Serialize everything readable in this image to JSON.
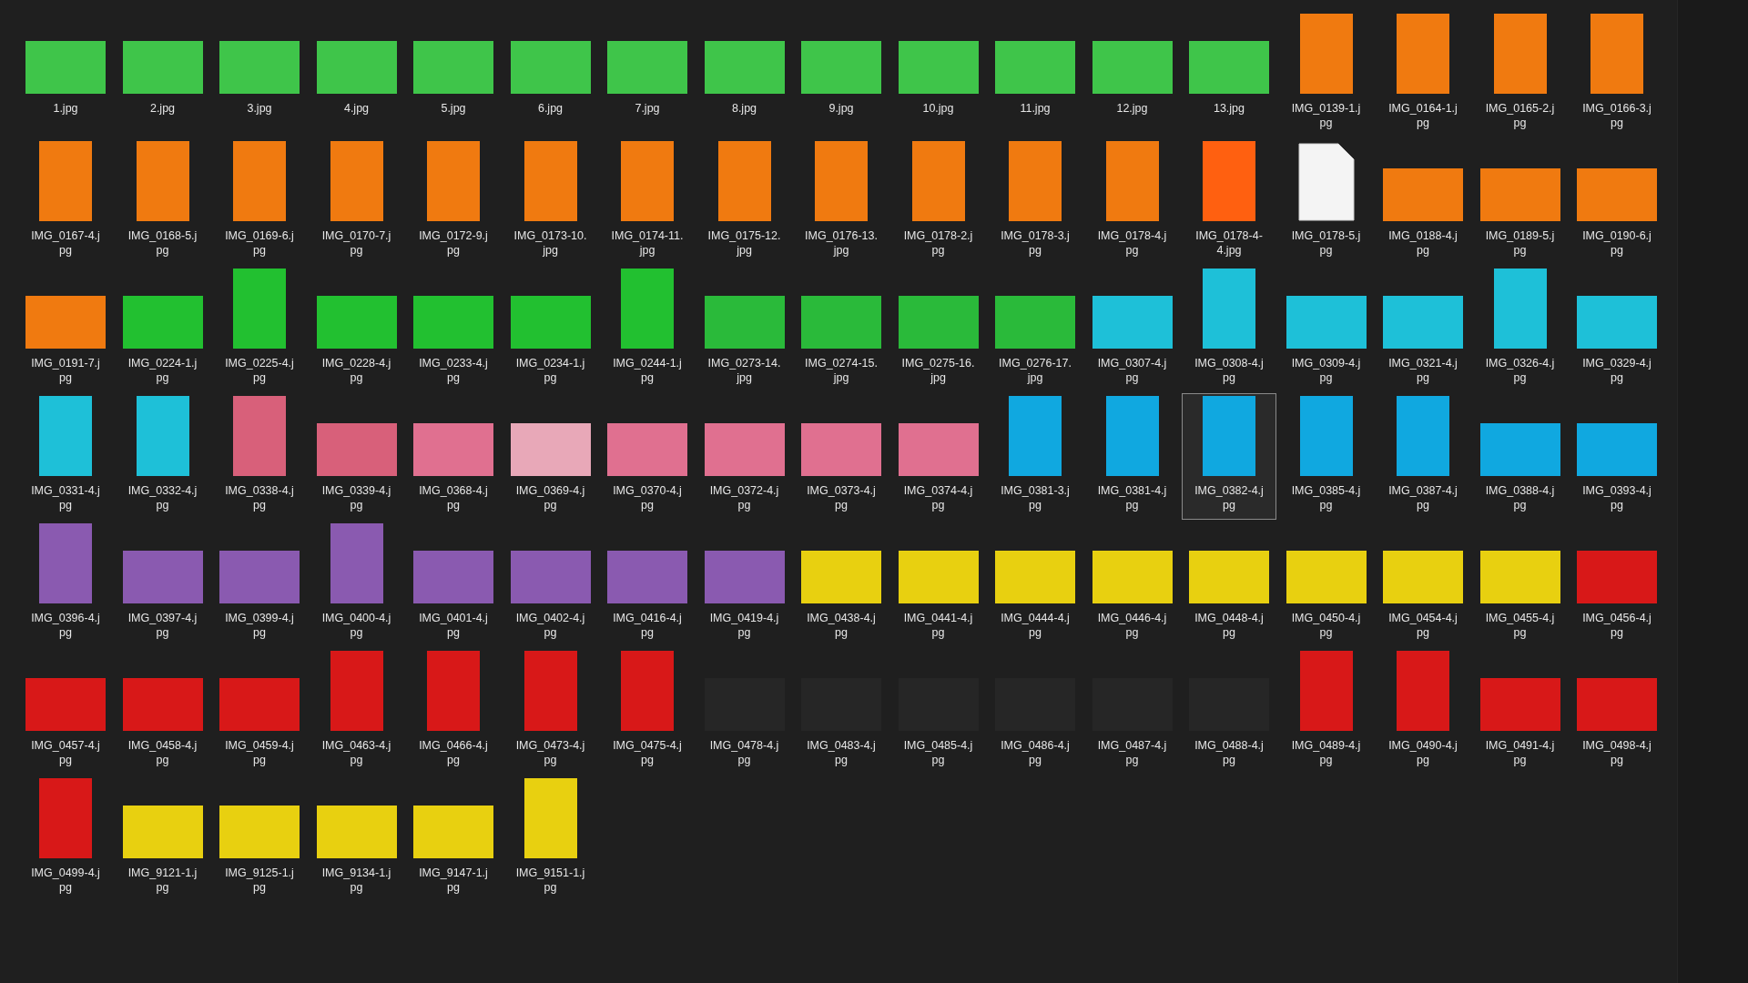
{
  "files": [
    {
      "name": "1.jpg",
      "kind": "landscape",
      "color": "#3fc54a",
      "selected": false
    },
    {
      "name": "2.jpg",
      "kind": "landscape",
      "color": "#3fc54a",
      "selected": false
    },
    {
      "name": "3.jpg",
      "kind": "landscape",
      "color": "#3fc54a",
      "selected": false
    },
    {
      "name": "4.jpg",
      "kind": "landscape",
      "color": "#3fc54a",
      "selected": false
    },
    {
      "name": "5.jpg",
      "kind": "landscape",
      "color": "#3fc54a",
      "selected": false
    },
    {
      "name": "6.jpg",
      "kind": "landscape",
      "color": "#3fc54a",
      "selected": false
    },
    {
      "name": "7.jpg",
      "kind": "landscape",
      "color": "#3fc54a",
      "selected": false
    },
    {
      "name": "8.jpg",
      "kind": "landscape",
      "color": "#3fc54a",
      "selected": false
    },
    {
      "name": "9.jpg",
      "kind": "landscape",
      "color": "#3fc54a",
      "selected": false
    },
    {
      "name": "10.jpg",
      "kind": "landscape",
      "color": "#3fc54a",
      "selected": false
    },
    {
      "name": "11.jpg",
      "kind": "landscape",
      "color": "#3fc54a",
      "selected": false
    },
    {
      "name": "12.jpg",
      "kind": "landscape",
      "color": "#3fc54a",
      "selected": false
    },
    {
      "name": "13.jpg",
      "kind": "landscape",
      "color": "#3fc54a",
      "selected": false
    },
    {
      "name": "IMG_0139-1.jpg",
      "kind": "portrait",
      "color": "#f07a10",
      "selected": false
    },
    {
      "name": "IMG_0164-1.jpg",
      "kind": "portrait",
      "color": "#f07a10",
      "selected": false
    },
    {
      "name": "IMG_0165-2.jpg",
      "kind": "portrait",
      "color": "#f07a10",
      "selected": false
    },
    {
      "name": "IMG_0166-3.jpg",
      "kind": "portrait",
      "color": "#f07a10",
      "selected": false
    },
    {
      "name": "IMG_0167-4.jpg",
      "kind": "portrait",
      "color": "#f07a10",
      "selected": false
    },
    {
      "name": "IMG_0168-5.jpg",
      "kind": "portrait",
      "color": "#f07a10",
      "selected": false
    },
    {
      "name": "IMG_0169-6.jpg",
      "kind": "portrait",
      "color": "#f07a10",
      "selected": false
    },
    {
      "name": "IMG_0170-7.jpg",
      "kind": "portrait",
      "color": "#f07a10",
      "selected": false
    },
    {
      "name": "IMG_0172-9.jpg",
      "kind": "portrait",
      "color": "#f07a10",
      "selected": false
    },
    {
      "name": "IMG_0173-10.jpg",
      "kind": "portrait",
      "color": "#f07a10",
      "selected": false
    },
    {
      "name": "IMG_0174-11.jpg",
      "kind": "portrait",
      "color": "#f07a10",
      "selected": false
    },
    {
      "name": "IMG_0175-12.jpg",
      "kind": "portrait",
      "color": "#f07a10",
      "selected": false
    },
    {
      "name": "IMG_0176-13.jpg",
      "kind": "portrait",
      "color": "#f07a10",
      "selected": false
    },
    {
      "name": "IMG_0178-2.jpg",
      "kind": "portrait",
      "color": "#f07a10",
      "selected": false
    },
    {
      "name": "IMG_0178-3.jpg",
      "kind": "portrait",
      "color": "#f07a10",
      "selected": false
    },
    {
      "name": "IMG_0178-4.jpg",
      "kind": "portrait",
      "color": "#f07a10",
      "selected": false
    },
    {
      "name": "IMG_0178-4-4.jpg",
      "kind": "portrait",
      "color": "#ff6010",
      "selected": false
    },
    {
      "name": "IMG_0178-5.jpg",
      "kind": "document",
      "color": "#f4f4f4",
      "selected": false
    },
    {
      "name": "IMG_0188-4.jpg",
      "kind": "landscape",
      "color": "#f07a10",
      "selected": false
    },
    {
      "name": "IMG_0189-5.jpg",
      "kind": "landscape",
      "color": "#f07a10",
      "selected": false
    },
    {
      "name": "IMG_0190-6.jpg",
      "kind": "landscape",
      "color": "#f07a10",
      "selected": false
    },
    {
      "name": "IMG_0191-7.jpg",
      "kind": "landscape",
      "color": "#f07a10",
      "selected": false
    },
    {
      "name": "IMG_0224-1.jpg",
      "kind": "landscape",
      "color": "#22c030",
      "selected": false
    },
    {
      "name": "IMG_0225-4.jpg",
      "kind": "portrait",
      "color": "#22c030",
      "selected": false
    },
    {
      "name": "IMG_0228-4.jpg",
      "kind": "landscape",
      "color": "#22c030",
      "selected": false
    },
    {
      "name": "IMG_0233-4.jpg",
      "kind": "landscape",
      "color": "#22c030",
      "selected": false
    },
    {
      "name": "IMG_0234-1.jpg",
      "kind": "landscape",
      "color": "#22c030",
      "selected": false
    },
    {
      "name": "IMG_0244-1.jpg",
      "kind": "portrait",
      "color": "#22c030",
      "selected": false
    },
    {
      "name": "IMG_0273-14.jpg",
      "kind": "landscape",
      "color": "#2aba3a",
      "selected": false
    },
    {
      "name": "IMG_0274-15.jpg",
      "kind": "landscape",
      "color": "#2aba3a",
      "selected": false
    },
    {
      "name": "IMG_0275-16.jpg",
      "kind": "landscape",
      "color": "#2aba3a",
      "selected": false
    },
    {
      "name": "IMG_0276-17.jpg",
      "kind": "landscape",
      "color": "#2aba3a",
      "selected": false
    },
    {
      "name": "IMG_0307-4.jpg",
      "kind": "landscape",
      "color": "#1ec0d8",
      "selected": false
    },
    {
      "name": "IMG_0308-4.jpg",
      "kind": "portrait",
      "color": "#1ec0d8",
      "selected": false
    },
    {
      "name": "IMG_0309-4.jpg",
      "kind": "landscape",
      "color": "#1ec0d8",
      "selected": false
    },
    {
      "name": "IMG_0321-4.jpg",
      "kind": "landscape",
      "color": "#1ec0d8",
      "selected": false
    },
    {
      "name": "IMG_0326-4.jpg",
      "kind": "portrait",
      "color": "#1ec0d8",
      "selected": false
    },
    {
      "name": "IMG_0329-4.jpg",
      "kind": "landscape",
      "color": "#1ec0d8",
      "selected": false
    },
    {
      "name": "IMG_0331-4.jpg",
      "kind": "portrait",
      "color": "#1ec0d8",
      "selected": false
    },
    {
      "name": "IMG_0332-4.jpg",
      "kind": "portrait",
      "color": "#1ec0d8",
      "selected": false
    },
    {
      "name": "IMG_0338-4.jpg",
      "kind": "portrait",
      "color": "#d8607a",
      "selected": false
    },
    {
      "name": "IMG_0339-4.jpg",
      "kind": "landscape",
      "color": "#d8607a",
      "selected": false
    },
    {
      "name": "IMG_0368-4.jpg",
      "kind": "landscape",
      "color": "#e07090",
      "selected": false
    },
    {
      "name": "IMG_0369-4.jpg",
      "kind": "landscape",
      "color": "#e8a8b8",
      "selected": false
    },
    {
      "name": "IMG_0370-4.jpg",
      "kind": "landscape",
      "color": "#e07090",
      "selected": false
    },
    {
      "name": "IMG_0372-4.jpg",
      "kind": "landscape",
      "color": "#e07090",
      "selected": false
    },
    {
      "name": "IMG_0373-4.jpg",
      "kind": "landscape",
      "color": "#e07090",
      "selected": false
    },
    {
      "name": "IMG_0374-4.jpg",
      "kind": "landscape",
      "color": "#e07090",
      "selected": false
    },
    {
      "name": "IMG_0381-3.jpg",
      "kind": "portrait",
      "color": "#10a8e0",
      "selected": false
    },
    {
      "name": "IMG_0381-4.jpg",
      "kind": "portrait",
      "color": "#10a8e0",
      "selected": false
    },
    {
      "name": "IMG_0382-4.jpg",
      "kind": "portrait",
      "color": "#10a8e0",
      "selected": true
    },
    {
      "name": "IMG_0385-4.jpg",
      "kind": "portrait",
      "color": "#10a8e0",
      "selected": false
    },
    {
      "name": "IMG_0387-4.jpg",
      "kind": "portrait",
      "color": "#10a8e0",
      "selected": false
    },
    {
      "name": "IMG_0388-4.jpg",
      "kind": "landscape",
      "color": "#10a8e0",
      "selected": false
    },
    {
      "name": "IMG_0393-4.jpg",
      "kind": "landscape",
      "color": "#10a8e0",
      "selected": false
    },
    {
      "name": "IMG_0396-4.jpg",
      "kind": "portrait",
      "color": "#8a5ab0",
      "selected": false
    },
    {
      "name": "IMG_0397-4.jpg",
      "kind": "landscape",
      "color": "#8a5ab0",
      "selected": false
    },
    {
      "name": "IMG_0399-4.jpg",
      "kind": "landscape",
      "color": "#8a5ab0",
      "selected": false
    },
    {
      "name": "IMG_0400-4.jpg",
      "kind": "portrait",
      "color": "#8a5ab0",
      "selected": false
    },
    {
      "name": "IMG_0401-4.jpg",
      "kind": "landscape",
      "color": "#8a5ab0",
      "selected": false
    },
    {
      "name": "IMG_0402-4.jpg",
      "kind": "landscape",
      "color": "#8a5ab0",
      "selected": false
    },
    {
      "name": "IMG_0416-4.jpg",
      "kind": "landscape",
      "color": "#8a5ab0",
      "selected": false
    },
    {
      "name": "IMG_0419-4.jpg",
      "kind": "landscape",
      "color": "#8a5ab0",
      "selected": false
    },
    {
      "name": "IMG_0438-4.jpg",
      "kind": "landscape",
      "color": "#e8d010",
      "selected": false
    },
    {
      "name": "IMG_0441-4.jpg",
      "kind": "landscape",
      "color": "#e8d010",
      "selected": false
    },
    {
      "name": "IMG_0444-4.jpg",
      "kind": "landscape",
      "color": "#e8d010",
      "selected": false
    },
    {
      "name": "IMG_0446-4.jpg",
      "kind": "landscape",
      "color": "#e8d010",
      "selected": false
    },
    {
      "name": "IMG_0448-4.jpg",
      "kind": "landscape",
      "color": "#e8d010",
      "selected": false
    },
    {
      "name": "IMG_0450-4.jpg",
      "kind": "landscape",
      "color": "#e8d010",
      "selected": false
    },
    {
      "name": "IMG_0454-4.jpg",
      "kind": "landscape",
      "color": "#e8d010",
      "selected": false
    },
    {
      "name": "IMG_0455-4.jpg",
      "kind": "landscape",
      "color": "#e8d010",
      "selected": false
    },
    {
      "name": "IMG_0456-4.jpg",
      "kind": "landscape",
      "color": "#d81818",
      "selected": false
    },
    {
      "name": "IMG_0457-4.jpg",
      "kind": "landscape",
      "color": "#d81818",
      "selected": false
    },
    {
      "name": "IMG_0458-4.jpg",
      "kind": "landscape",
      "color": "#d81818",
      "selected": false
    },
    {
      "name": "IMG_0459-4.jpg",
      "kind": "landscape",
      "color": "#d81818",
      "selected": false
    },
    {
      "name": "IMG_0463-4.jpg",
      "kind": "portrait",
      "color": "#d81818",
      "selected": false
    },
    {
      "name": "IMG_0466-4.jpg",
      "kind": "portrait",
      "color": "#d81818",
      "selected": false
    },
    {
      "name": "IMG_0473-4.jpg",
      "kind": "portrait",
      "color": "#d81818",
      "selected": false
    },
    {
      "name": "IMG_0475-4.jpg",
      "kind": "portrait",
      "color": "#d81818",
      "selected": false
    },
    {
      "name": "IMG_0478-4.jpg",
      "kind": "landscape",
      "color": "#262626",
      "selected": false
    },
    {
      "name": "IMG_0483-4.jpg",
      "kind": "landscape",
      "color": "#262626",
      "selected": false
    },
    {
      "name": "IMG_0485-4.jpg",
      "kind": "landscape",
      "color": "#262626",
      "selected": false
    },
    {
      "name": "IMG_0486-4.jpg",
      "kind": "landscape",
      "color": "#262626",
      "selected": false
    },
    {
      "name": "IMG_0487-4.jpg",
      "kind": "landscape",
      "color": "#262626",
      "selected": false
    },
    {
      "name": "IMG_0488-4.jpg",
      "kind": "landscape",
      "color": "#262626",
      "selected": false
    },
    {
      "name": "IMG_0489-4.jpg",
      "kind": "portrait",
      "color": "#d81818",
      "selected": false
    },
    {
      "name": "IMG_0490-4.jpg",
      "kind": "portrait",
      "color": "#d81818",
      "selected": false
    },
    {
      "name": "IMG_0491-4.jpg",
      "kind": "landscape",
      "color": "#d81818",
      "selected": false
    },
    {
      "name": "IMG_0498-4.jpg",
      "kind": "landscape",
      "color": "#d81818",
      "selected": false
    },
    {
      "name": "IMG_0499-4.jpg",
      "kind": "portrait",
      "color": "#d81818",
      "selected": false
    },
    {
      "name": "IMG_9121-1.jpg",
      "kind": "landscape",
      "color": "#e8d010",
      "selected": false
    },
    {
      "name": "IMG_9125-1.jpg",
      "kind": "landscape",
      "color": "#e8d010",
      "selected": false
    },
    {
      "name": "IMG_9134-1.jpg",
      "kind": "landscape",
      "color": "#e8d010",
      "selected": false
    },
    {
      "name": "IMG_9147-1.jpg",
      "kind": "landscape",
      "color": "#e8d010",
      "selected": false
    },
    {
      "name": "IMG_9151-1.jpg",
      "kind": "portrait",
      "color": "#e8d010",
      "selected": false
    }
  ]
}
